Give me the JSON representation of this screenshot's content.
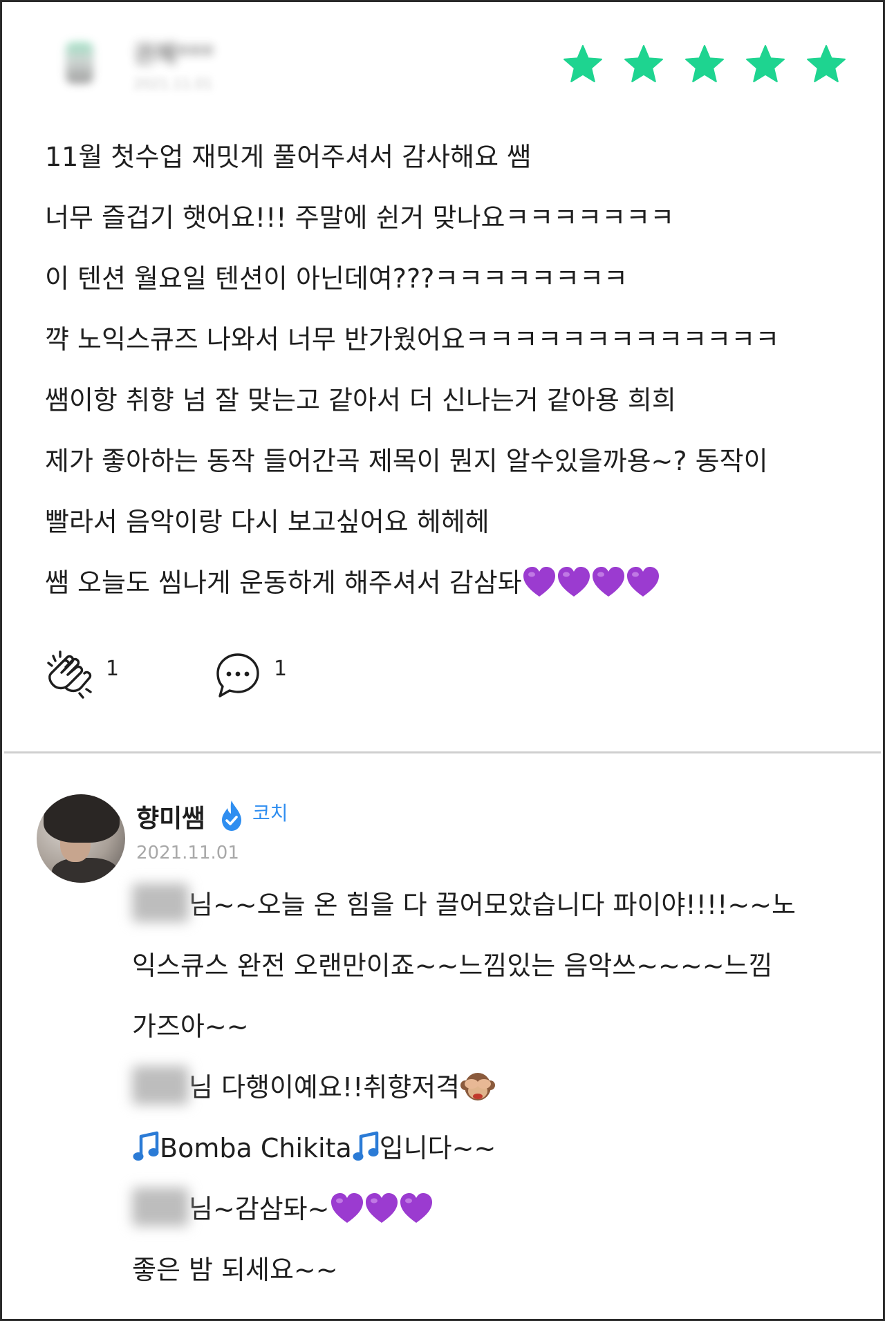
{
  "review": {
    "reviewer_name": "권혜***",
    "reviewer_date": "2021.11.01",
    "rating": 5,
    "star_color": "#1ed490",
    "lines": [
      "11월 첫수업 재밋게 풀어주셔서 감사해요 쌤",
      "너무 즐겁기 햇어요!!! 주말에 쉰거 맞나요ㅋㅋㅋㅋㅋㅋㅋ",
      "이 텐션 월요일 텐션이 아닌데여???ㅋㅋㅋㅋㅋㅋㅋㅋ",
      "꺅 노익스큐즈 나와서 너무 반가웠어요ㅋㅋㅋㅋㅋㅋㅋㅋㅋㅋㅋㅋㅋ",
      "쌤이항 취향 넘 잘 맞는고 같아서 더 신나는거 같아용 희희",
      "제가 좋아하는 동작 들어간곡 제목이 뭔지 알수있을까용~? 동작이",
      "빨라서 음악이랑 다시 보고싶어요 헤헤헤",
      "쌤 오늘도 씸나게 운동하게 해주셔서 감삼돠"
    ],
    "clap_count": "1",
    "comment_count": "1"
  },
  "reply": {
    "name": "향미쌤",
    "badge": "코치",
    "date": "2021.11.01",
    "badge_color": "#2f8ef0",
    "lines": [
      "님~~오늘 온 힘을 다 끌어모았습니다 파이야!!!!~~노",
      "익스큐스 완전 오랜만이죠~~느낌있는 음악쓰~~~~느낌",
      "가즈아~~",
      "님 다행이예요!!취향저격",
      "Bomba Chikita",
      "입니다~~",
      "님~감삼돠~",
      "좋은 밤 되세요~~"
    ]
  },
  "icons": {
    "clap": "clapping-hands-icon",
    "comment": "speech-bubble-icon",
    "verified": "verified-check-icon",
    "heart": "purple-heart-emoji",
    "note": "musical-note-emoji",
    "monkey": "see-no-evil-monkey-emoji"
  },
  "colors": {
    "heart": "#9b3bd0",
    "note": "#2b7bd6",
    "divider": "#cfcfcf"
  }
}
